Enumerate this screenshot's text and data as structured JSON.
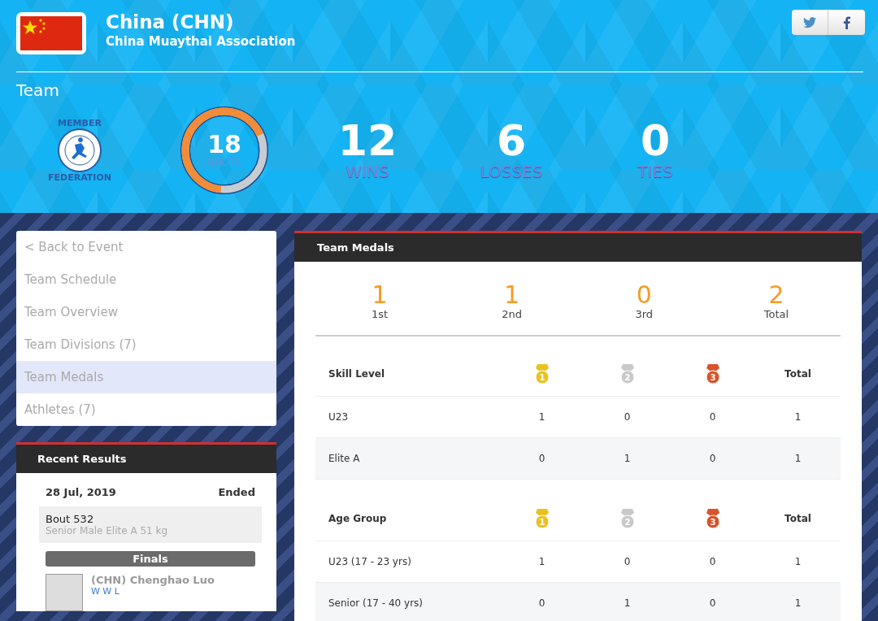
{
  "header": {
    "country": "China (CHN)",
    "association": "China Muaythai Association",
    "section": "Team",
    "share_buttons": [
      {
        "kind": "twitter"
      },
      {
        "kind": "facebook"
      }
    ]
  },
  "member_badge": {
    "top": "MEMBER",
    "bottom": "FEDERATION"
  },
  "stats": {
    "bouts": {
      "value": "18",
      "label": "BOUTS",
      "level": 0.67
    },
    "items": [
      {
        "value": "12",
        "label": "WINS"
      },
      {
        "value": "6",
        "label": "LOSSES"
      },
      {
        "value": "0",
        "label": "TIES"
      }
    ]
  },
  "nav": [
    {
      "label": "< Back to Event",
      "selected": false
    },
    {
      "label": "Team Schedule",
      "selected": false
    },
    {
      "label": "Team Overview",
      "selected": false
    },
    {
      "label": "Team Divisions (7)",
      "selected": false
    },
    {
      "label": "Team Medals",
      "selected": true
    },
    {
      "label": "Athletes (7)",
      "selected": false
    }
  ],
  "recent_results": {
    "title": "Recent Results",
    "date": "28 Jul, 2019",
    "status": "Ended",
    "bout": "Bout 532",
    "division": "Senior Male Elite A 51 kg",
    "round": "Finals",
    "athlete": "(CHN) Chenghao Luo",
    "record": "W W L"
  },
  "medals": {
    "title": "Team Medals",
    "summary": [
      {
        "value": "1",
        "label": "1st"
      },
      {
        "value": "1",
        "label": "2nd"
      },
      {
        "value": "0",
        "label": "3rd"
      },
      {
        "value": "2",
        "label": "Total"
      }
    ],
    "tables": [
      {
        "title": "Skill Level",
        "total_label": "Total",
        "medal_icons": [
          {
            "rank": "1",
            "color": "#e8c21e"
          },
          {
            "rank": "2",
            "color": "#c9c9c9"
          },
          {
            "rank": "3",
            "color": "#d9532b"
          }
        ],
        "rows": [
          {
            "name": "U23",
            "cells": [
              "1",
              "0",
              "0",
              "1"
            ]
          },
          {
            "name": "Elite A",
            "cells": [
              "0",
              "1",
              "0",
              "1"
            ]
          }
        ]
      },
      {
        "title": "Age Group",
        "total_label": "Total",
        "medal_icons": [
          {
            "rank": "1",
            "color": "#e8c21e"
          },
          {
            "rank": "2",
            "color": "#c9c9c9"
          },
          {
            "rank": "3",
            "color": "#d9532b"
          }
        ],
        "rows": [
          {
            "name": "U23 (17 - 23 yrs)",
            "cells": [
              "1",
              "0",
              "0",
              "1"
            ]
          },
          {
            "name": "Senior (17 - 40 yrs)",
            "cells": [
              "0",
              "1",
              "0",
              "1"
            ]
          }
        ]
      }
    ]
  }
}
